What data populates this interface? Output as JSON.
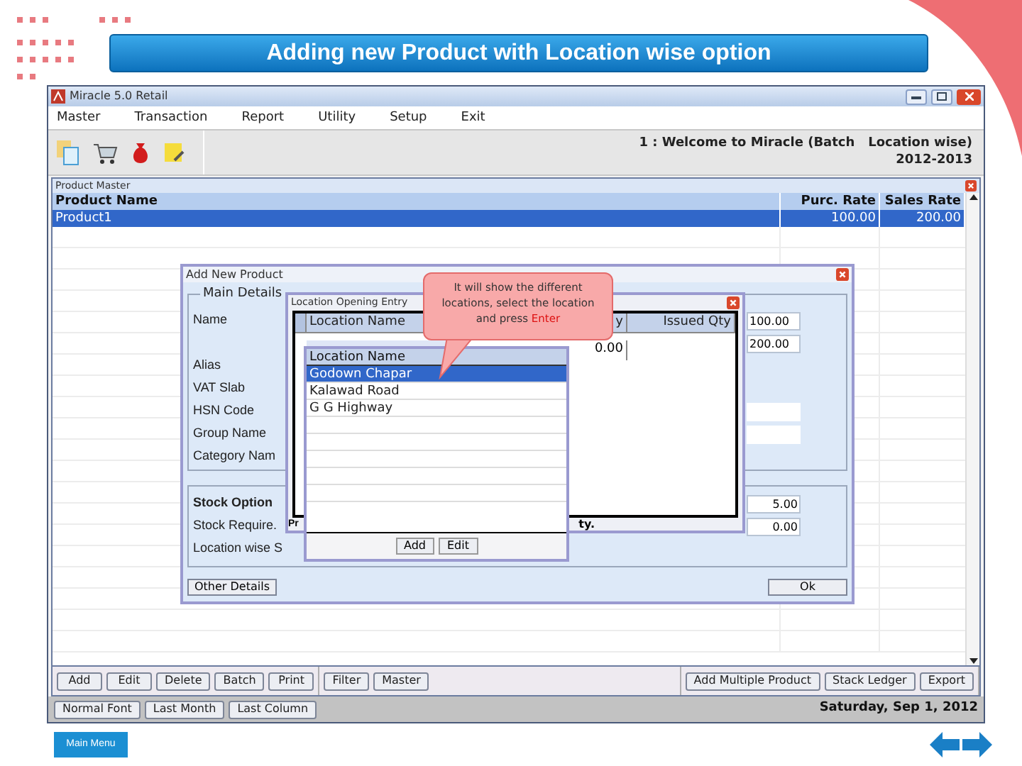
{
  "slide": {
    "title": "Adding new Product with Location wise option",
    "main_menu_button": "Main Menu"
  },
  "window": {
    "title": "Miracle 5.0 Retail",
    "menu": [
      "Master",
      "Transaction",
      "Report",
      "Utility",
      "Setup",
      "Exit"
    ],
    "welcome": "1 : Welcome to Miracle (Batch   Location wise)",
    "year": "2012-2013"
  },
  "product_master": {
    "title": "Product Master",
    "columns": [
      "Product Name",
      "Purc. Rate",
      "Sales Rate"
    ],
    "rows": [
      {
        "cells": [
          "Product1",
          "100.00",
          "200.00"
        ],
        "selected": true
      }
    ]
  },
  "button_groups": [
    [
      "Add",
      "Edit",
      "Delete",
      "Batch",
      "Print"
    ],
    [
      "Filter",
      "Master"
    ],
    [
      "Add Multiple Product",
      "Stack Ledger",
      "Export"
    ]
  ],
  "status_bar": {
    "buttons": [
      "Normal Font",
      "Last Month",
      "Last Column"
    ],
    "date": "Saturday, Sep 1, 2012"
  },
  "add_product_dialog": {
    "title": "Add New Product",
    "main_details": {
      "legend": "Main Details",
      "rows": [
        {
          "label": "Name",
          "value": "100.00"
        },
        {
          "value": "200.00"
        },
        {
          "label": "Alias"
        },
        {
          "label": "VAT Slab"
        },
        {
          "label": "HSN Code",
          "has_field": true
        },
        {
          "label": "Group Name",
          "has_field": true
        },
        {
          "label": "Category Nam"
        }
      ]
    },
    "stock_options": {
      "legend": "Stock Option",
      "rows": [
        {
          "value": "5.00"
        },
        {
          "label": "Stock Require.",
          "value": "0.00"
        },
        {
          "label": "Location wise S"
        }
      ]
    },
    "buttons": [
      "Other Details",
      "Ok"
    ]
  },
  "location_dialog": {
    "title": "Location Opening Entry",
    "columns": [
      "Location Name",
      "y",
      "Issued Qty"
    ],
    "row_value": "0.00",
    "footer_left": "Pr",
    "footer_right": "ty."
  },
  "location_list": {
    "header": "Location Name",
    "items": [
      {
        "label": "Godown Chapar",
        "selected": true
      },
      {
        "label": "Kalawad Road",
        "selected": false
      },
      {
        "label": "G G Highway",
        "selected": false
      }
    ],
    "buttons": [
      "Add",
      "Edit"
    ]
  },
  "callout": {
    "text": "It will show the different locations, select the location and press",
    "highlight": "Enter"
  }
}
